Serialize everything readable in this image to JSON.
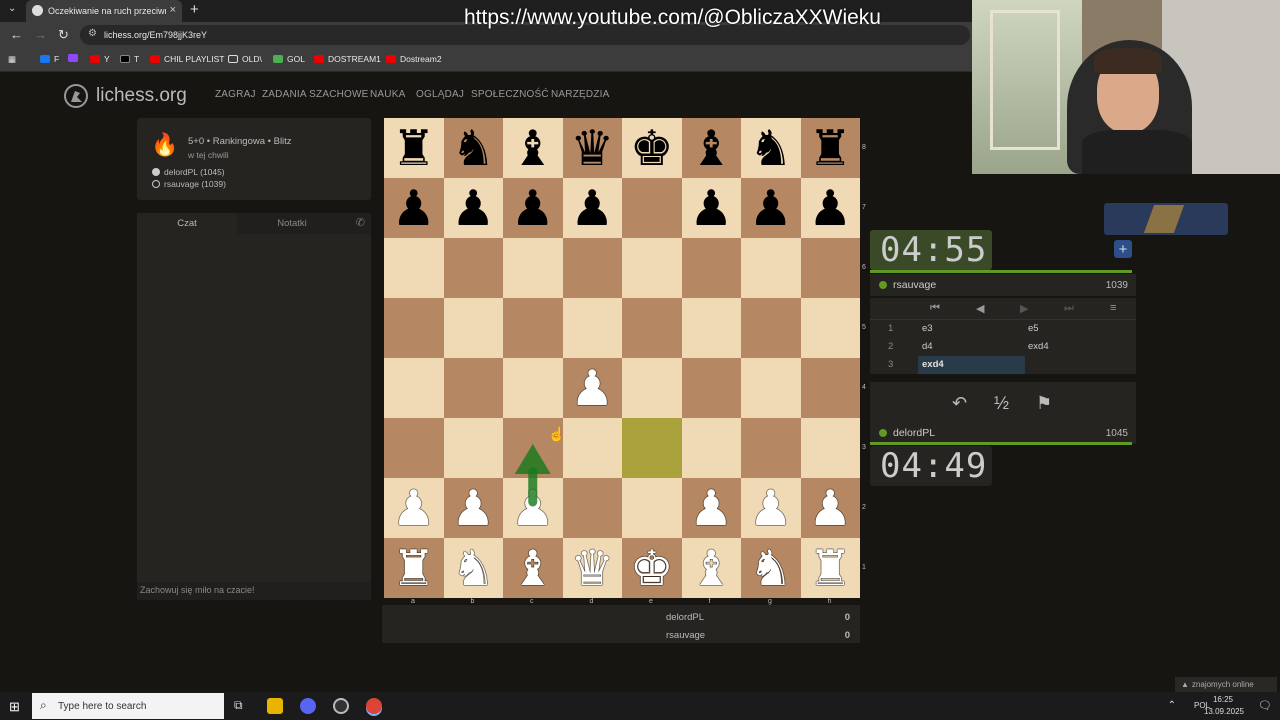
{
  "browser": {
    "tab_title": "Oczekiwanie na ruch przeciwnika",
    "url": "lichess.org/Em798jjK3reY",
    "bookmarks": [
      "F",
      "Y",
      "T",
      "CHIL PLAYLIST",
      "OLD\\",
      "GOL",
      "DOSTREAM1",
      "Dostream2"
    ]
  },
  "site": {
    "logo": "lichess.org",
    "nav": [
      "ZAGRAJ",
      "ZADANIA SZACHOWE",
      "NAUKA",
      "OGLĄDAJ",
      "SPOŁECZNOŚĆ",
      "NARZĘDZIA"
    ]
  },
  "game": {
    "mode": "5+0 • Rankingowa • Blitz",
    "when": "w tej chwili",
    "white_player": "delordPL (1045)",
    "black_player": "rsauvage (1039)"
  },
  "chat": {
    "tab_chat": "Czat",
    "tab_notes": "Notatki",
    "placeholder": "Zachowuj się miło na czacie!"
  },
  "board": {
    "files": [
      "a",
      "b",
      "c",
      "d",
      "e",
      "f",
      "g",
      "h"
    ],
    "ranks": [
      "8",
      "7",
      "6",
      "5",
      "4",
      "3",
      "2",
      "1"
    ],
    "position": [
      [
        "r",
        "n",
        "b",
        "q",
        "k",
        "b",
        "n",
        "r"
      ],
      [
        "p",
        "p",
        "p",
        "p",
        "",
        "p",
        "p",
        "p"
      ],
      [
        "",
        "",
        "",
        "",
        "",
        "",
        "",
        ""
      ],
      [
        "",
        "",
        "",
        "",
        "",
        "",
        "",
        ""
      ],
      [
        "",
        "",
        "",
        "P",
        "",
        "",
        "",
        ""
      ],
      [
        "",
        "",
        "",
        "",
        "",
        "",
        "",
        ""
      ],
      [
        "P",
        "P",
        "P",
        "",
        "",
        "P",
        "P",
        "P"
      ],
      [
        "R",
        "N",
        "B",
        "Q",
        "K",
        "B",
        "N",
        "R"
      ]
    ],
    "highlighted_square": "e3",
    "arrow": {
      "from": "c2",
      "to": "c3",
      "color": "#15781b"
    }
  },
  "scores": [
    {
      "name": "delordPL",
      "value": "0"
    },
    {
      "name": "rsauvage",
      "value": "0"
    }
  ],
  "clocks": {
    "opponent_time": "04:55",
    "player_time": "04:49"
  },
  "opponent": {
    "name": "rsauvage",
    "rating": "1039"
  },
  "player": {
    "name": "delordPL",
    "rating": "1045"
  },
  "moves": [
    {
      "num": "1",
      "white": "e3",
      "black": "e5"
    },
    {
      "num": "2",
      "white": "d4",
      "black": "exd4"
    },
    {
      "num": "3",
      "white": "exd4",
      "black": ""
    }
  ],
  "actions": {
    "draw": "½"
  },
  "overlay": {
    "youtube_url": "https://www.youtube.com/@ObliczaXXWieku",
    "friends": "znajomych online"
  },
  "taskbar": {
    "search_placeholder": "Type here to search",
    "lang": "POL",
    "time": "16:25",
    "date": "13.09.2025"
  }
}
